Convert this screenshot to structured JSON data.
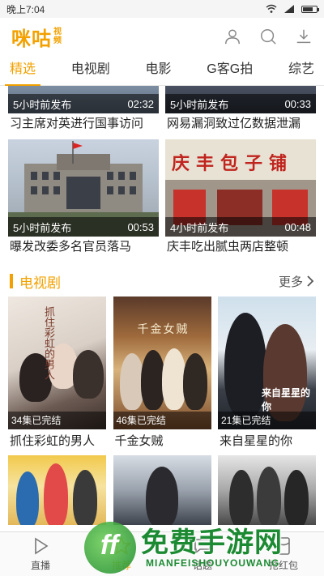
{
  "status": {
    "time": "晚上7:04"
  },
  "header": {
    "logo_main": "咪咕",
    "logo_sub_1": "视",
    "logo_sub_2": "频"
  },
  "tabs": [
    "精选",
    "电视剧",
    "电影",
    "G客G拍",
    "综艺"
  ],
  "news": [
    {
      "time": "5小时前发布",
      "duration": "02:32",
      "title": "习主席对英进行国事访问"
    },
    {
      "time": "5小时前发布",
      "duration": "00:33",
      "title": "网易漏洞致过亿数据泄漏"
    },
    {
      "time": "5小时前发布",
      "duration": "00:53",
      "title": "曝发改委多名官员落马"
    },
    {
      "time": "4小时前发布",
      "duration": "00:48",
      "title": "庆丰吃出腻虫两店整顿"
    }
  ],
  "news_signage": "庆丰包子铺",
  "section": {
    "title": "电视剧",
    "more": "更多"
  },
  "tv": [
    {
      "badge": "34集已完结",
      "title": "抓住彩虹的男人",
      "poster_text": "抓住彩虹的男人"
    },
    {
      "badge": "46集已完结",
      "title": "千金女贼",
      "poster_text": "千金女贼"
    },
    {
      "badge": "21集已完结",
      "title": "来自星星的你",
      "poster_text": "来自星星的你"
    }
  ],
  "bottom_nav": [
    "直播",
    "推荐",
    "话题",
    "抢红包"
  ],
  "watermark": {
    "text": "免费手游网",
    "sub": "MIANFEISHOUYOUWANG"
  },
  "colors": {
    "accent": "#f2a100",
    "watermark": "#1c8a32"
  }
}
